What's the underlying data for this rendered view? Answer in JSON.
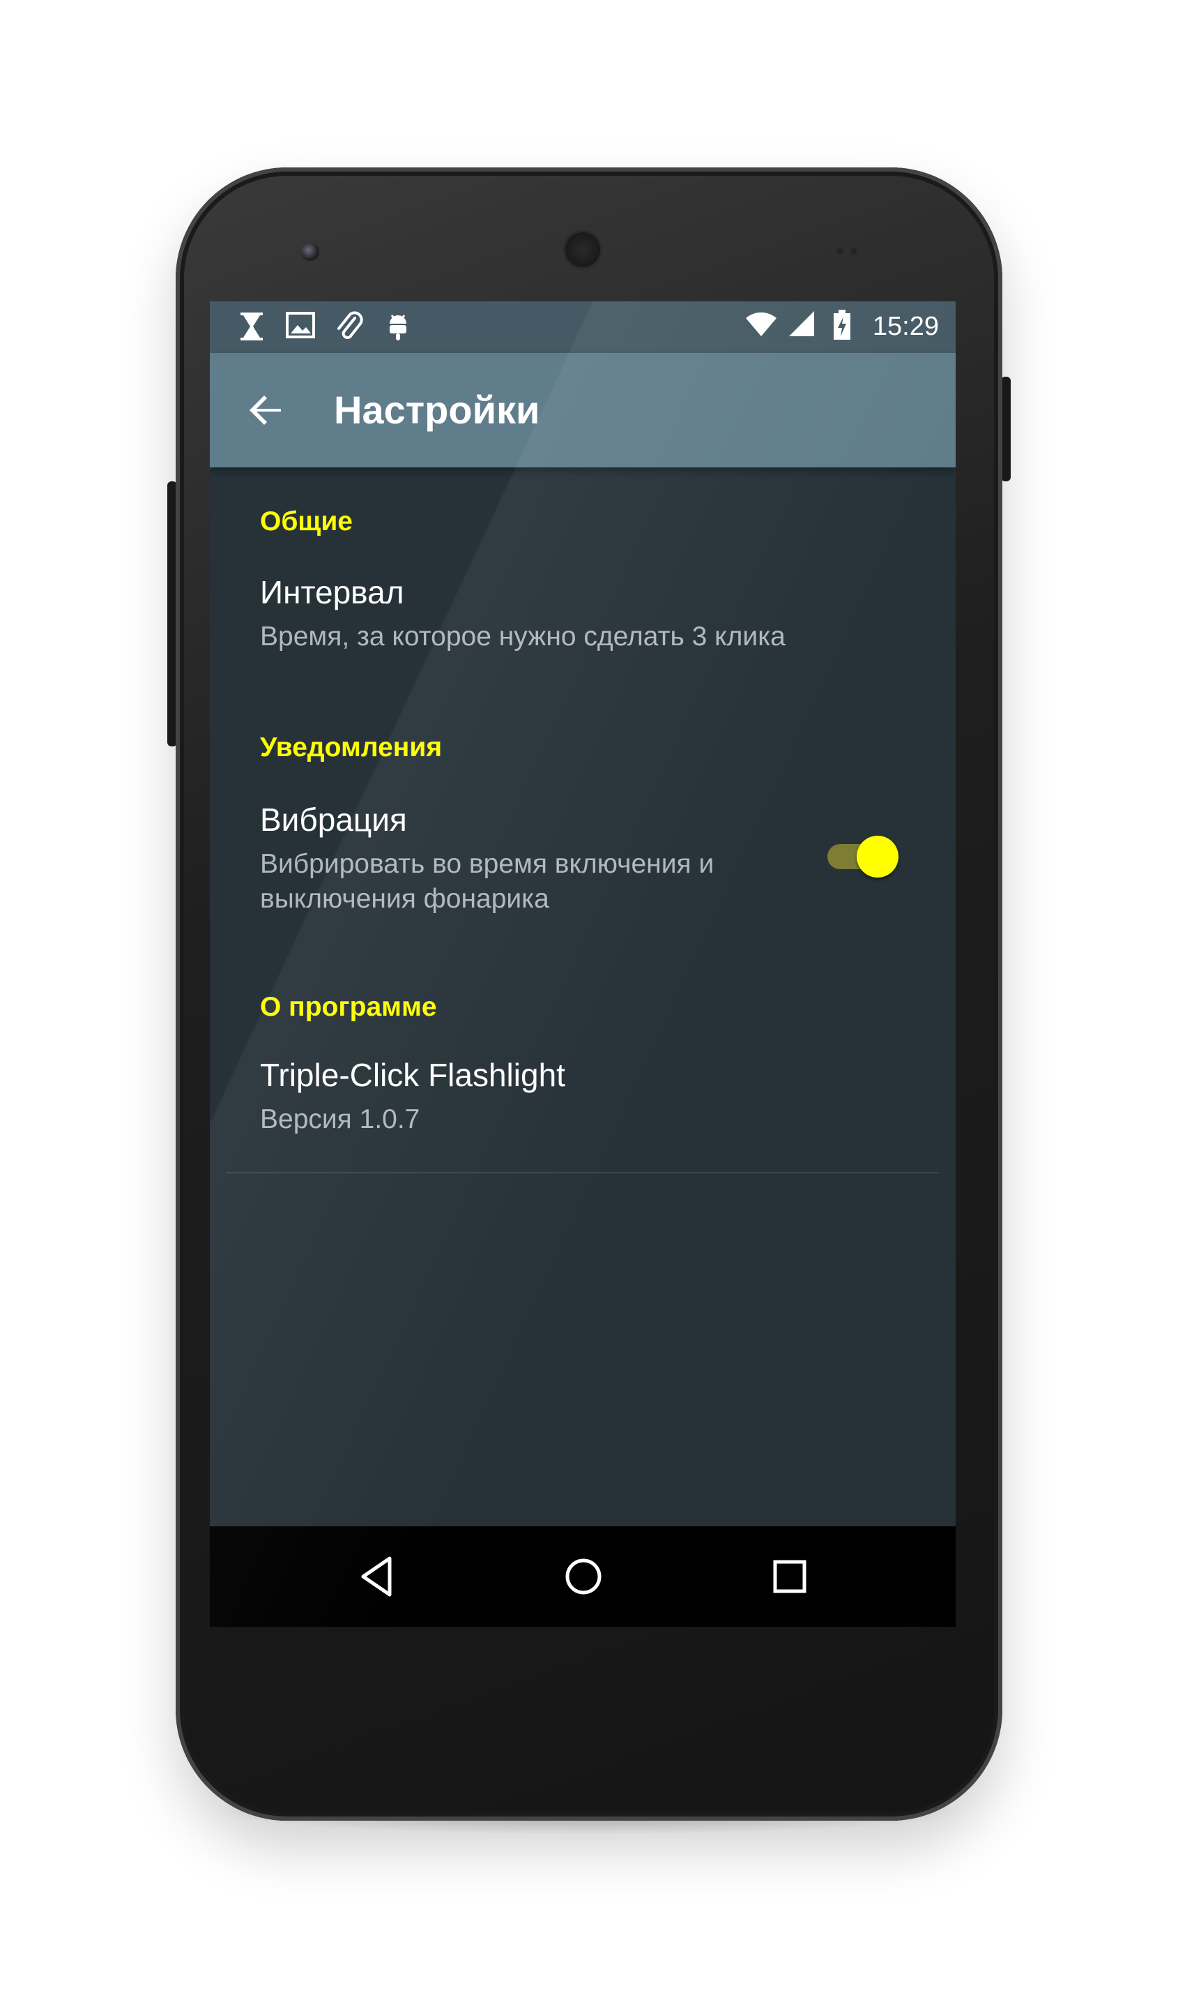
{
  "status_bar": {
    "time": "15:29",
    "left_icons": [
      "hourglass-icon",
      "image-icon",
      "paperclip-icon",
      "android-icon"
    ],
    "right_icons": [
      "wifi-icon",
      "cell-signal-icon",
      "battery-charging-icon"
    ]
  },
  "app_bar": {
    "title": "Настройки",
    "back_icon": "arrow-left-icon"
  },
  "sections": [
    {
      "header": "Общие",
      "items": [
        {
          "title": "Интервал",
          "summary": "Время, за которое нужно сделать 3 клика"
        }
      ]
    },
    {
      "header": "Уведомления",
      "items": [
        {
          "title": "Вибрация",
          "summary": "Вибрировать во время включения и выключения фонарика",
          "switch_on": true
        }
      ]
    },
    {
      "header": "О программе",
      "items": [
        {
          "title": "Triple-Click Flashlight",
          "summary": "Версия 1.0.7"
        }
      ]
    }
  ],
  "nav_bar": {
    "buttons": [
      "back-triangle-icon",
      "home-circle-icon",
      "recents-square-icon"
    ]
  },
  "colors": {
    "status_bar": "#455a64",
    "app_bar": "#607d8b",
    "background": "#263238",
    "accent": "#ffff00"
  }
}
